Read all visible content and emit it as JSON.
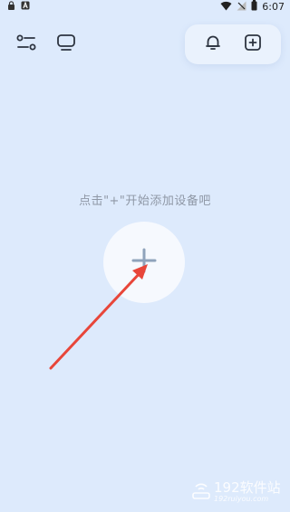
{
  "status_bar": {
    "time": "6:07",
    "left_icons": [
      "lock-icon",
      "a-icon"
    ],
    "right_icons": [
      "wifi-icon",
      "no-signal-icon",
      "battery-icon"
    ]
  },
  "top_bar": {
    "left_icons": [
      "filter-sliders-icon",
      "display-icon"
    ],
    "right_icons": [
      "bell-icon",
      "add-square-icon"
    ]
  },
  "empty_state": {
    "hint": "点击\"+\"开始添加设备吧",
    "add_icon": "plus-icon"
  },
  "annotation": {
    "arrow_color": "#e8463a"
  },
  "watermark": {
    "title": "192软件站",
    "subtitle": "192ruiyou.com"
  },
  "colors": {
    "background": "#ddeafc",
    "hint_text": "#8f98a6",
    "icon": "#2d3440",
    "plus": "#8fa3bb"
  }
}
